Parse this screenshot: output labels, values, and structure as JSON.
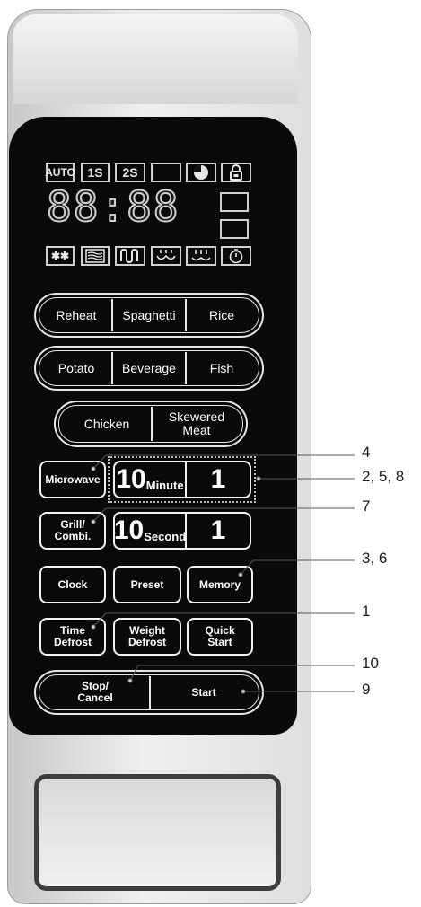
{
  "display": {
    "top_icons": [
      "AUTO",
      "1S",
      "2S",
      "",
      "pie-chart-icon",
      "lock-icon"
    ],
    "digits": "88:88",
    "bottom_icons": [
      "snowflake-icon",
      "grill-icon",
      "wave-icon",
      "combi1-icon",
      "combi2-icon",
      "timer-icon"
    ]
  },
  "buttons": {
    "row1": [
      "Reheat",
      "Spaghetti",
      "Rice"
    ],
    "row2": [
      "Potato",
      "Beverage",
      "Fish"
    ],
    "row3": [
      "Chicken",
      "Skewered\nMeat"
    ],
    "microwave": "Microwave",
    "grill": "Grill/\nCombi.",
    "minute_10": "10",
    "minute_label": "Minute",
    "minute_1": "1",
    "second_10": "10",
    "second_label": "Second",
    "second_1": "1",
    "clock": "Clock",
    "preset": "Preset",
    "memory": "Memory",
    "time_defrost": "Time\nDefrost",
    "weight_defrost": "Weight\nDefrost",
    "quick_start": "Quick\nStart",
    "stop_cancel": "Stop/\nCancel",
    "start": "Start"
  },
  "callouts": [
    "4",
    "2, 5, 8",
    "7",
    "3, 6",
    "1",
    "10",
    "9"
  ]
}
